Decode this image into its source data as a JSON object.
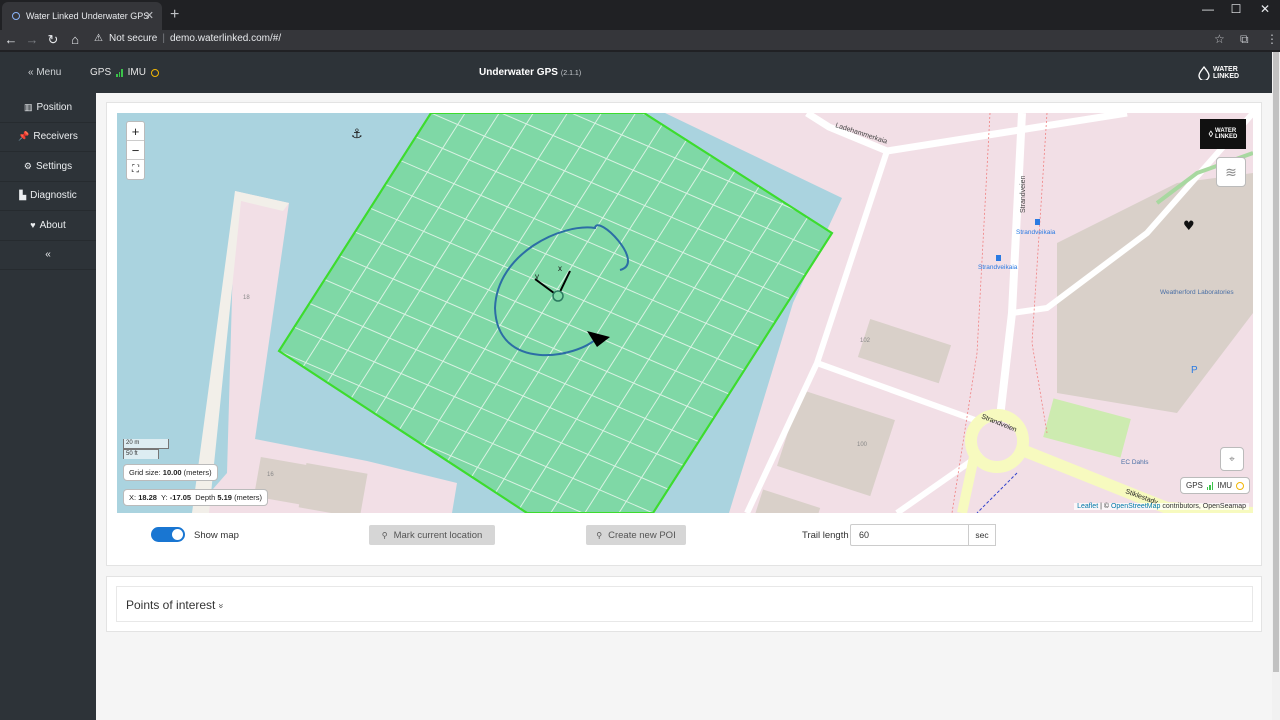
{
  "browser": {
    "tab_title": "Water Linked Underwater GPS",
    "tab_close": "✕",
    "new_tab": "+",
    "security": "Not secure",
    "url": "demo.waterlinked.com/#/",
    "win_min": "—",
    "win_max": "☐",
    "win_close": "✕"
  },
  "header": {
    "menu_label": "Menu",
    "gps_label": "GPS",
    "imu_label": "IMU",
    "title": "Underwater GPS",
    "version": "(2.1.1)",
    "logo_line1": "WATER",
    "logo_line2": "LINKED"
  },
  "sidebar": {
    "items": [
      {
        "label": "Position",
        "icon": "map-icon"
      },
      {
        "label": "Receivers",
        "icon": "pushpin-icon"
      },
      {
        "label": "Settings",
        "icon": "gears-icon"
      },
      {
        "label": "Diagnostic",
        "icon": "bar-chart-icon"
      },
      {
        "label": "About",
        "icon": "heart-icon"
      }
    ],
    "collapse": "«"
  },
  "map": {
    "zoom_in": "+",
    "zoom_out": "−",
    "fullscreen": "⛶",
    "scale_m": "20 m",
    "scale_ft": "50 ft",
    "grid_label": "Grid size:",
    "grid_value": "10.00",
    "grid_unit": "(meters)",
    "x_label": "X:",
    "x_value": "18.28",
    "y_label": "Y:",
    "y_value": "-17.05",
    "depth_label": "Depth",
    "depth_value": "5.19",
    "pos_unit": "(meters)",
    "badge_line1": "WATER",
    "badge_line2": "LINKED",
    "mini_gps": "GPS",
    "mini_imu": "IMU",
    "attr_leaflet": "Leaflet",
    "attr_sep": " | © ",
    "attr_osm": "OpenStreetMap",
    "attr_rest": " contributors, OpenSeamap",
    "labels": {
      "street1": "Ladehammerkaia",
      "street2": "Strandveien",
      "street3": "Strandveien",
      "street4": "Stiklestadv",
      "stop1": "Strandveikaia",
      "stop2": "Strandveikaia",
      "building": "Weatherford Laboratories",
      "shop": "EC Dahls",
      "num18": "18",
      "num16": "16",
      "num102": "102",
      "num100": "100",
      "parking": "P",
      "axis_x": "x",
      "axis_y": "y"
    },
    "colors": {
      "water": "#aad3df",
      "land": "#f2dfe6",
      "grid_fill": "#7fd8a6",
      "grid_border": "#3ddc2e",
      "trail": "#2c6ea5",
      "road": "#f7fabf"
    }
  },
  "controls": {
    "show_map_label": "Show map",
    "mark_btn": "Mark current location",
    "create_btn": "Create new POI",
    "trail_label": "Trail length",
    "trail_value": "60",
    "trail_unit": "sec"
  },
  "poi": {
    "title": "Points of interest",
    "chevron": "»"
  }
}
